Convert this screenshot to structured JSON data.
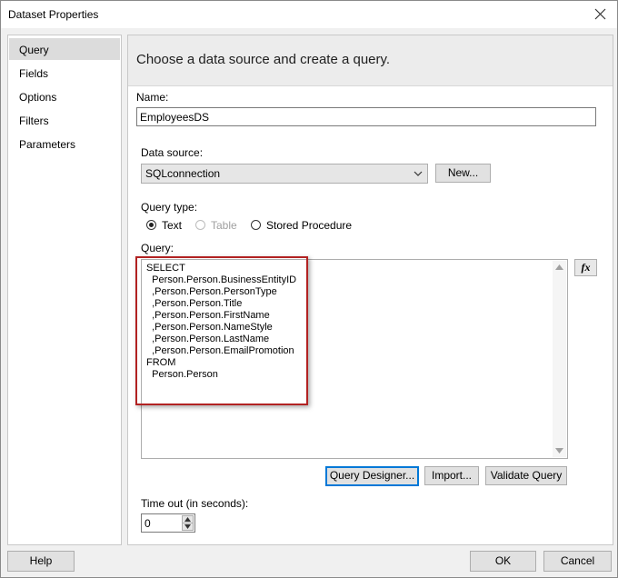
{
  "window": {
    "title": "Dataset Properties"
  },
  "nav": {
    "items": [
      "Query",
      "Fields",
      "Options",
      "Filters",
      "Parameters"
    ],
    "selected": "Query"
  },
  "panel": {
    "header": "Choose a data source and create a query.",
    "name_label": "Name:",
    "name_value": "EmployeesDS",
    "datasource_label": "Data source:",
    "datasource_value": "SQLconnection",
    "new_button": "New...",
    "query_type_label": "Query type:",
    "query_types": {
      "text": "Text",
      "table": "Table",
      "stored_procedure": "Stored Procedure"
    },
    "query_type_selected": "Text",
    "query_label": "Query:",
    "query_text": "SELECT\n  Person.Person.BusinessEntityID\n  ,Person.Person.PersonType\n  ,Person.Person.Title\n  ,Person.Person.FirstName\n  ,Person.Person.NameStyle\n  ,Person.Person.LastName\n  ,Person.Person.EmailPromotion\nFROM\n  Person.Person",
    "fx_button": "fx",
    "query_designer_button": "Query Designer...",
    "import_button": "Import...",
    "validate_button": "Validate Query",
    "timeout_label": "Time out (in seconds):",
    "timeout_value": "0"
  },
  "footer": {
    "help": "Help",
    "ok": "OK",
    "cancel": "Cancel"
  },
  "colors": {
    "accent": "#0078d7",
    "highlight": "#b22222"
  },
  "icons": [
    "close-icon",
    "chevron-down-icon",
    "scroll-up-icon",
    "scroll-down-icon",
    "spin-up-icon",
    "spin-down-icon"
  ]
}
